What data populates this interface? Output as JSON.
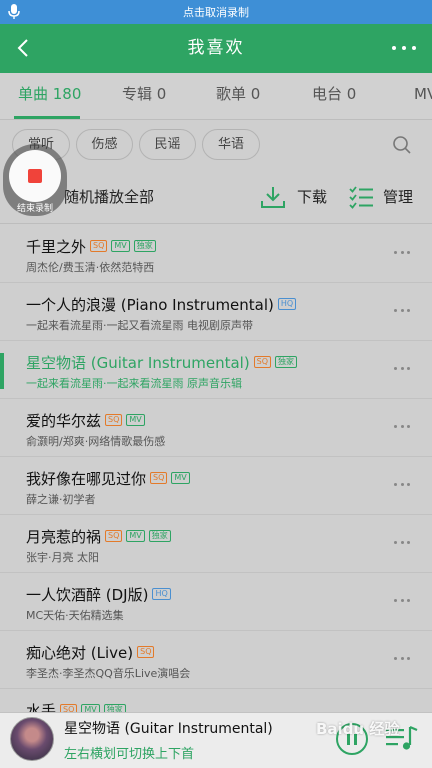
{
  "recording_bar": {
    "text": "点击取消录制"
  },
  "header": {
    "title": "我喜欢"
  },
  "tabs": [
    {
      "label": "单曲 180"
    },
    {
      "label": "专辑 0"
    },
    {
      "label": "歌单 0"
    },
    {
      "label": "电台 0"
    },
    {
      "label": "MV"
    }
  ],
  "tags": [
    "常听",
    "伤感",
    "民谣",
    "华语"
  ],
  "recorder": {
    "label": "结束录制"
  },
  "toolbar": {
    "shuffle": "随机播放全部",
    "download": "下载",
    "manage": "管理"
  },
  "songs": [
    {
      "name": "千里之外",
      "artist": "周杰伦/费玉清·依然范特西"
    },
    {
      "name": "一个人的浪漫 (Piano Instrumental)",
      "artist": "一起来看流星雨·一起又看流星雨 电视剧原声带"
    },
    {
      "name": "星空物语 (Guitar Instrumental)",
      "artist": "一起来看流星雨·一起来看流星雨 原声音乐辑"
    },
    {
      "name": "爱的华尔兹",
      "artist": "俞灏明/郑爽·网络情歌最伤感"
    },
    {
      "name": "我好像在哪见过你",
      "artist": "薛之谦·初学者"
    },
    {
      "name": "月亮惹的祸",
      "artist": "张宇·月亮 太阳"
    },
    {
      "name": "一人饮酒醉 (DJ版)",
      "artist": "MC天佑·天佑精选集"
    },
    {
      "name": "痴心绝对 (Live)",
      "artist": "李圣杰·李圣杰QQ音乐Live演唱会"
    },
    {
      "name": "水手",
      "artist": ""
    }
  ],
  "badges": {
    "sq": "SQ",
    "hq": "HQ",
    "mv": "MV",
    "exclusive": "独家"
  },
  "player": {
    "title": "星空物语 (Guitar Instrumental)",
    "hint": "左右横划可切换上下首"
  },
  "watermark": "Baidu 经验",
  "colors": {
    "accent": "#2ea463",
    "recording_bar": "#3e8fd6",
    "sq": "#e37a2a",
    "hq": "#4a8fd0",
    "stop": "#f0433a"
  }
}
